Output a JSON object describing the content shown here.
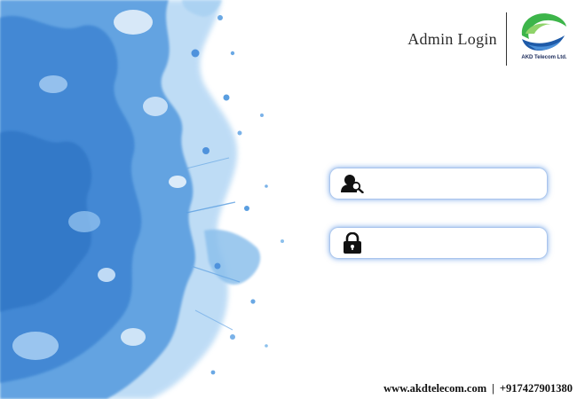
{
  "header": {
    "title": "Admin Login",
    "logo_text": "AKD Telecom Ltd."
  },
  "form": {
    "username": {
      "value": "",
      "placeholder": "",
      "icon": "user-search-icon"
    },
    "password": {
      "value": "",
      "placeholder": "",
      "icon": "lock-icon"
    }
  },
  "footer": {
    "website": "www.akdtelecom.com",
    "separator": "|",
    "phone": "+917427901380"
  },
  "colors": {
    "splash_primary": "#4a90d9",
    "splash_light": "#9cc8f0",
    "field_glow": "#5a96e6",
    "logo_green": "#3db54a",
    "logo_blue": "#1e5aa8"
  }
}
